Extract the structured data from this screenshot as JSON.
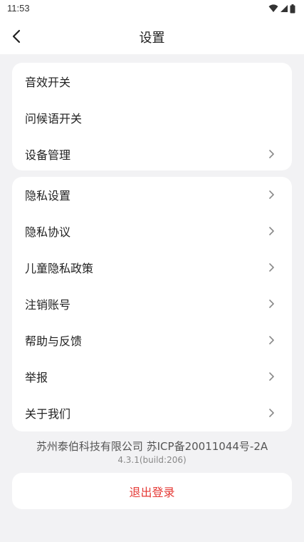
{
  "status_bar": {
    "time": "11:53",
    "icons": [
      "wifi-icon",
      "signal-icon",
      "battery-icon"
    ]
  },
  "header": {
    "title": "设置",
    "back_icon": "chevron-left-icon"
  },
  "section1": {
    "items": [
      {
        "label": "音效开关",
        "has_chevron": false
      },
      {
        "label": "问候语开关",
        "has_chevron": false
      },
      {
        "label": "设备管理",
        "has_chevron": true
      }
    ]
  },
  "section2": {
    "items": [
      {
        "label": "隐私设置",
        "has_chevron": true
      },
      {
        "label": "隐私协议",
        "has_chevron": true
      },
      {
        "label": "儿童隐私政策",
        "has_chevron": true
      },
      {
        "label": "注销账号",
        "has_chevron": true
      },
      {
        "label": "帮助与反馈",
        "has_chevron": true
      },
      {
        "label": "举报",
        "has_chevron": true
      },
      {
        "label": "关于我们",
        "has_chevron": true
      }
    ]
  },
  "footer": {
    "company": "苏州泰伯科技有限公司  苏ICP备20011044号-2A",
    "version": "4.3.1(build:206)"
  },
  "logout": {
    "label": "退出登录",
    "color": "#e53935"
  }
}
